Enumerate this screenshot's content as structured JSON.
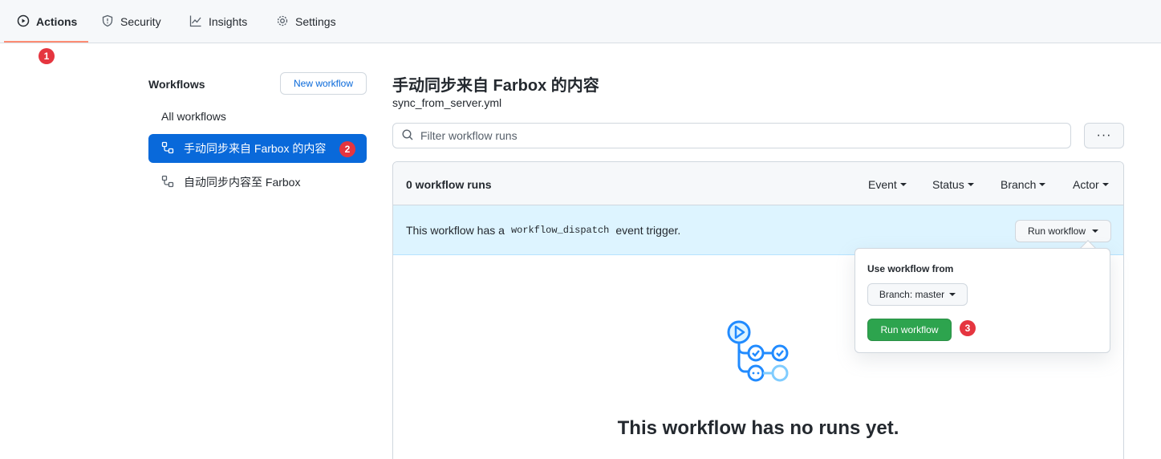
{
  "nav": {
    "tabs": [
      {
        "label": "Actions",
        "icon": "play-circle-icon"
      },
      {
        "label": "Security",
        "icon": "shield-icon"
      },
      {
        "label": "Insights",
        "icon": "graph-icon"
      },
      {
        "label": "Settings",
        "icon": "gear-icon"
      }
    ],
    "active_underline_color": "#fd8c73"
  },
  "badges": [
    "1",
    "2",
    "3"
  ],
  "sidebar": {
    "title": "Workflows",
    "new_workflow_label": "New workflow",
    "items": [
      {
        "label": "All workflows"
      },
      {
        "label": "手动同步来自 Farbox 的内容",
        "icon": "workflow-icon"
      },
      {
        "label": "自动同步内容至 Farbox",
        "icon": "workflow-icon"
      }
    ],
    "selected_color": "#0969da"
  },
  "main": {
    "title": "手动同步来自 Farbox 的内容",
    "file": "sync_from_server.yml",
    "filter_placeholder": "Filter workflow runs",
    "more_label": "···",
    "runs_count": "0 workflow runs",
    "filters": [
      "Event",
      "Status",
      "Branch",
      "Actor"
    ],
    "dispatch": {
      "prefix": "This workflow has a",
      "code": "workflow_dispatch",
      "suffix": "event trigger."
    },
    "run_workflow_label": "Run workflow",
    "empty_title": "This workflow has no runs yet."
  },
  "popover": {
    "title": "Use workflow from",
    "branch_label": "Branch: master",
    "run_button_label": "Run workflow",
    "run_button_color": "#2da44e"
  }
}
